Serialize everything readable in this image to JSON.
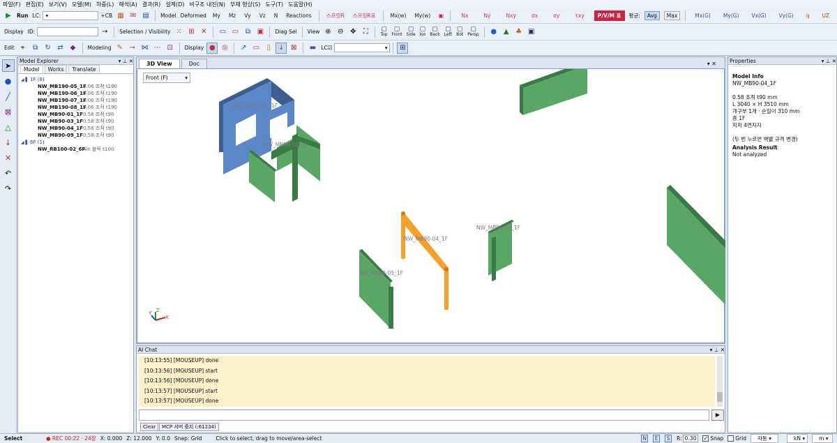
{
  "menu": [
    "파일(F)",
    "편집(E)",
    "보기(V)",
    "모델(M)",
    "하중(L)",
    "해석(A)",
    "결과(R)",
    "설계(D)",
    "비구조 내진(N)",
    "부재 형상(S)",
    "도구(T)",
    "도움말(H)"
  ],
  "tb1": {
    "run": "Run",
    "lc": "LC:",
    "cb": "+CB",
    "model": "Model",
    "deformed": "Deformed",
    "results": [
      "My",
      "Mz",
      "Vy",
      "Vz",
      "N",
      "Reactions"
    ],
    "results_red": [
      "스프링R",
      "스프링R표"
    ],
    "results2": [
      "Mx(w)",
      "My(w)"
    ],
    "results_pink": [
      "Nx",
      "Ny",
      "Nxy",
      "σx",
      "σy",
      "τxy"
    ],
    "pvm": "P/V/M 표",
    "smooth_label": "평균:",
    "avg": "Avg",
    "max": "Max",
    "results3": [
      "Mx(G)",
      "My(G)",
      "Vx(G)",
      "Vy(G)",
      "q",
      "UZ"
    ]
  },
  "tb2": {
    "display": "Display",
    "id": "ID:",
    "sel": "Selection / Visibility",
    "diag": "Diag Sel",
    "view": "View",
    "views": [
      "Top",
      "Front",
      "Side",
      "Iso",
      "Back",
      "Left",
      "Bot",
      "Persp"
    ]
  },
  "tb3": {
    "edit": "Edit",
    "modeling": "Modeling",
    "display": "Display",
    "lc": "LC☑"
  },
  "explorer": {
    "title": "Model Explorer",
    "tabs": [
      "Model",
      "Works",
      "Translate"
    ],
    "group1": "1F  (8)",
    "items1": [
      {
        "name": "NW_MB190-05_1F",
        "info": "1.06 조적 t190"
      },
      {
        "name": "NW_MB190-06_1F",
        "info": "1.06 조적 t190"
      },
      {
        "name": "NW_MB190-07_1F",
        "info": "1.06 조적 t190"
      },
      {
        "name": "NW_MB190-08_1F",
        "info": "1.06 조적 t190"
      },
      {
        "name": "NW_MB90-01_1F",
        "info": "0.58 조적 t90"
      },
      {
        "name": "NW_MB90-03_1F",
        "info": "0.58 조적 t90"
      },
      {
        "name": "NW_MB90-04_1F",
        "info": "0.58 조적 t90"
      },
      {
        "name": "NW_MB90-09_1F",
        "info": "0.58 조적 t90"
      }
    ],
    "group2": "6F  (1)",
    "items2": [
      {
        "name": "NW_RB100-02_6F",
        "info": "4in 블럭 t100"
      }
    ]
  },
  "main": {
    "tabs": [
      "3D View",
      "Doc"
    ],
    "view_select": "Front (F)",
    "labels": [
      "NW_MB90-01_1F",
      "NW_MB90-03_1F",
      "NW_MB90-04_1F",
      "NW_MB90-06_1F",
      "NW_MB90-05_1F"
    ],
    "colors": {
      "blue": "#5b86c8",
      "green": "#5aa765",
      "orange": "#f5a02a"
    }
  },
  "chat": {
    "title": "AI Chat",
    "log": [
      "[10:13:55] [MOUSEUP] done",
      "[10:13:56] [MOUSEUP] start",
      "[10:13:56] [MOUSEUP] done",
      "[10:13:57] [MOUSEUP] start",
      "[10:13:57] [MOUSEUP] done"
    ],
    "clear": "Clear",
    "mcp": "MCP 서버 중지 (:61234)"
  },
  "props": {
    "title": "Properties",
    "model_info": "Model Info",
    "name": "NW_MB90-04_1F",
    "l1": "0.58 조적  t90 mm",
    "l2": "L 3040 × H 3510 mm",
    "l3": "개구부 1개 · 순길이 310 mm",
    "l4": "층 1F",
    "l5": "지지 4면지지",
    "l6": "(두 번 누르면 벽별 규격 변경)",
    "analysis": "Analysis Result",
    "analysis_val": "Not analyzed"
  },
  "status": {
    "mode": "Select",
    "rec": "● REC 00:22 · 24장",
    "x": "X: 0.000",
    "z": "Z: 12.000",
    "y": "Y: 0.0",
    "snap": "Snap: Grid",
    "hint": "Click to select, drag to move/area-select",
    "nes": [
      "N",
      "E",
      "S"
    ],
    "r": "R:",
    "rval": "0.30",
    "snap_chk": "Snap",
    "grid_chk": "Grid",
    "auto": "자동",
    "unit1": "kN",
    "unit2": "m"
  }
}
